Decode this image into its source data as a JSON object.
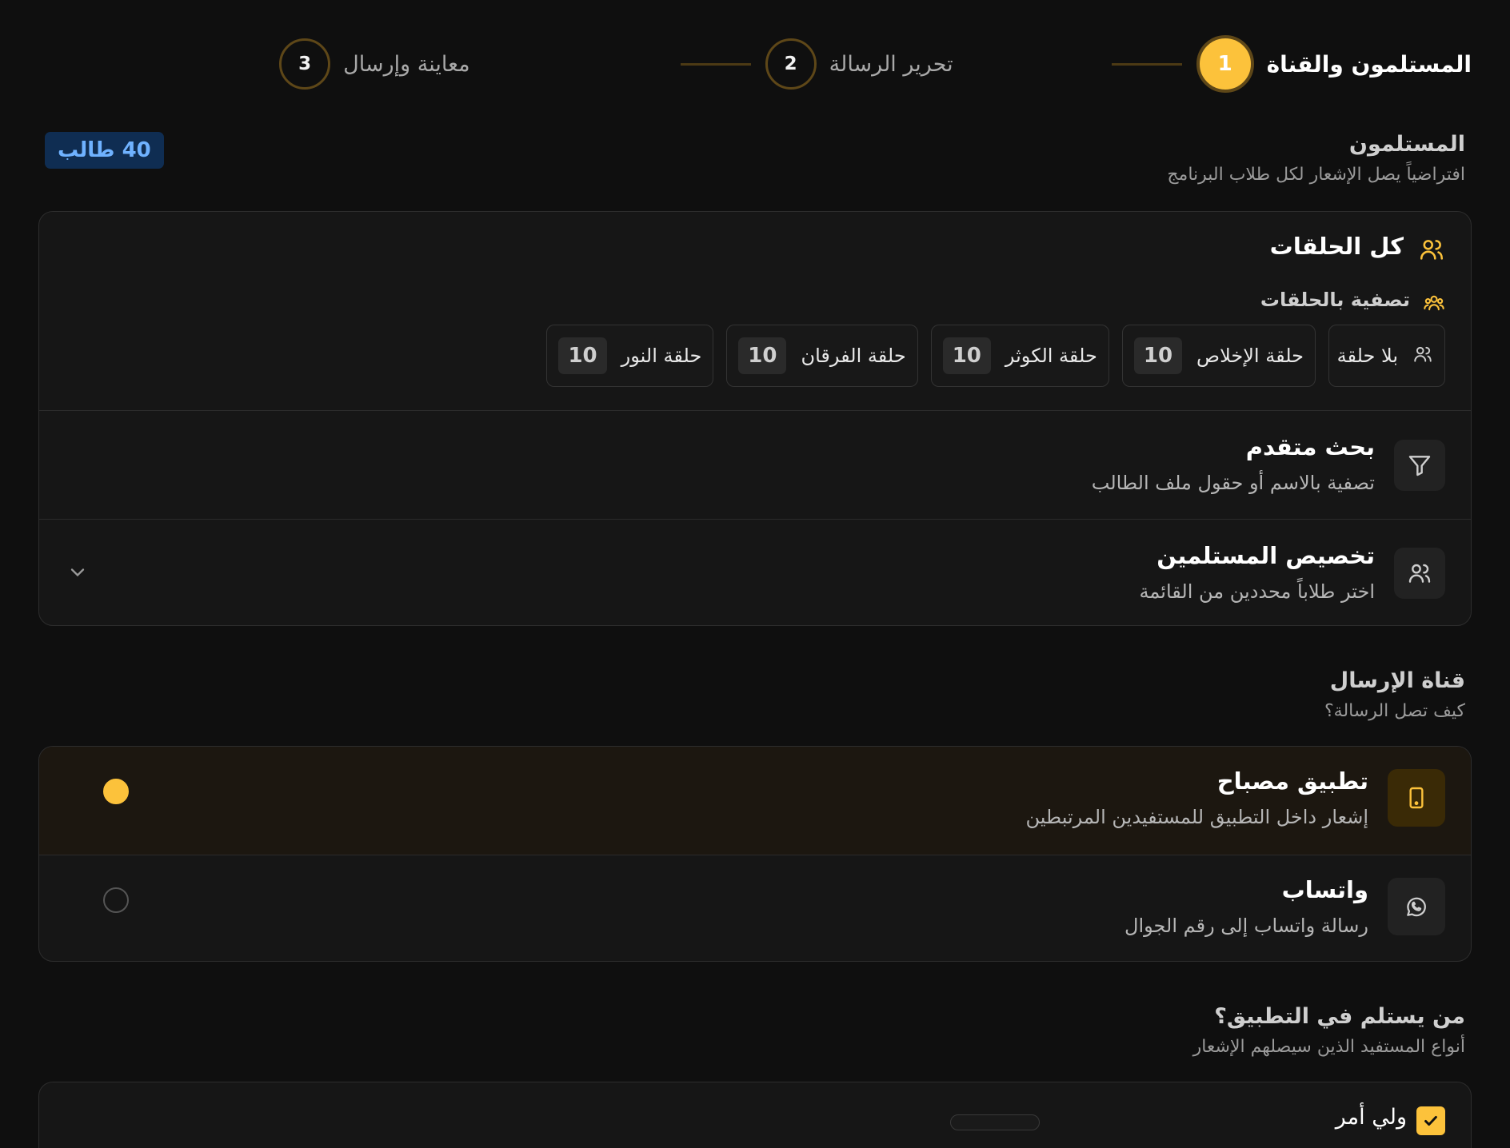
{
  "stepper": {
    "steps": [
      {
        "number": "1",
        "label": "المستلمون والقناة"
      },
      {
        "number": "2",
        "label": "تحرير الرسالة"
      },
      {
        "number": "3",
        "label": "معاينة وإرسال"
      }
    ]
  },
  "recipients": {
    "title": "المستلمون",
    "subtitle": "افتراضياً يصل الإشعار لكل طلاب البرنامج",
    "count_badge": "40 طالب",
    "all_circles": "كل الحلقات",
    "filter_by_circles": "تصفية بالحلقات",
    "chips": [
      {
        "label": "بلا حلقة",
        "count": ""
      },
      {
        "label": "حلقة الإخلاص",
        "count": "10"
      },
      {
        "label": "حلقة الكوثر",
        "count": "10"
      },
      {
        "label": "حلقة الفرقان",
        "count": "10"
      },
      {
        "label": "حلقة النور",
        "count": "10"
      }
    ],
    "advanced_search": {
      "title": "بحث متقدم",
      "subtitle": "تصفية بالاسم أو حقول ملف الطالب"
    },
    "customize": {
      "title": "تخصيص المستلمين",
      "subtitle": "اختر طلاباً محددين من القائمة"
    }
  },
  "channel": {
    "title": "قناة الإرسال",
    "subtitle": "كيف تصل الرسالة؟",
    "options": [
      {
        "title": "تطبيق مصباح",
        "subtitle": "إشعار داخل التطبيق للمستفيدين المرتبطين",
        "selected": true
      },
      {
        "title": "واتساب",
        "subtitle": "رسالة واتساب إلى رقم الجوال",
        "selected": false
      }
    ]
  },
  "app_recipients": {
    "title": "من يستلم في التطبيق؟",
    "subtitle": "أنواع المستفيد الذين سيصلهم الإشعار",
    "guardian_label": "ولي أمر"
  },
  "colors": {
    "accent": "#fcc23b",
    "background": "#0f0f0f",
    "card": "#161616",
    "badge_bg": "#0f2d52",
    "badge_text": "#6fb2ff"
  }
}
